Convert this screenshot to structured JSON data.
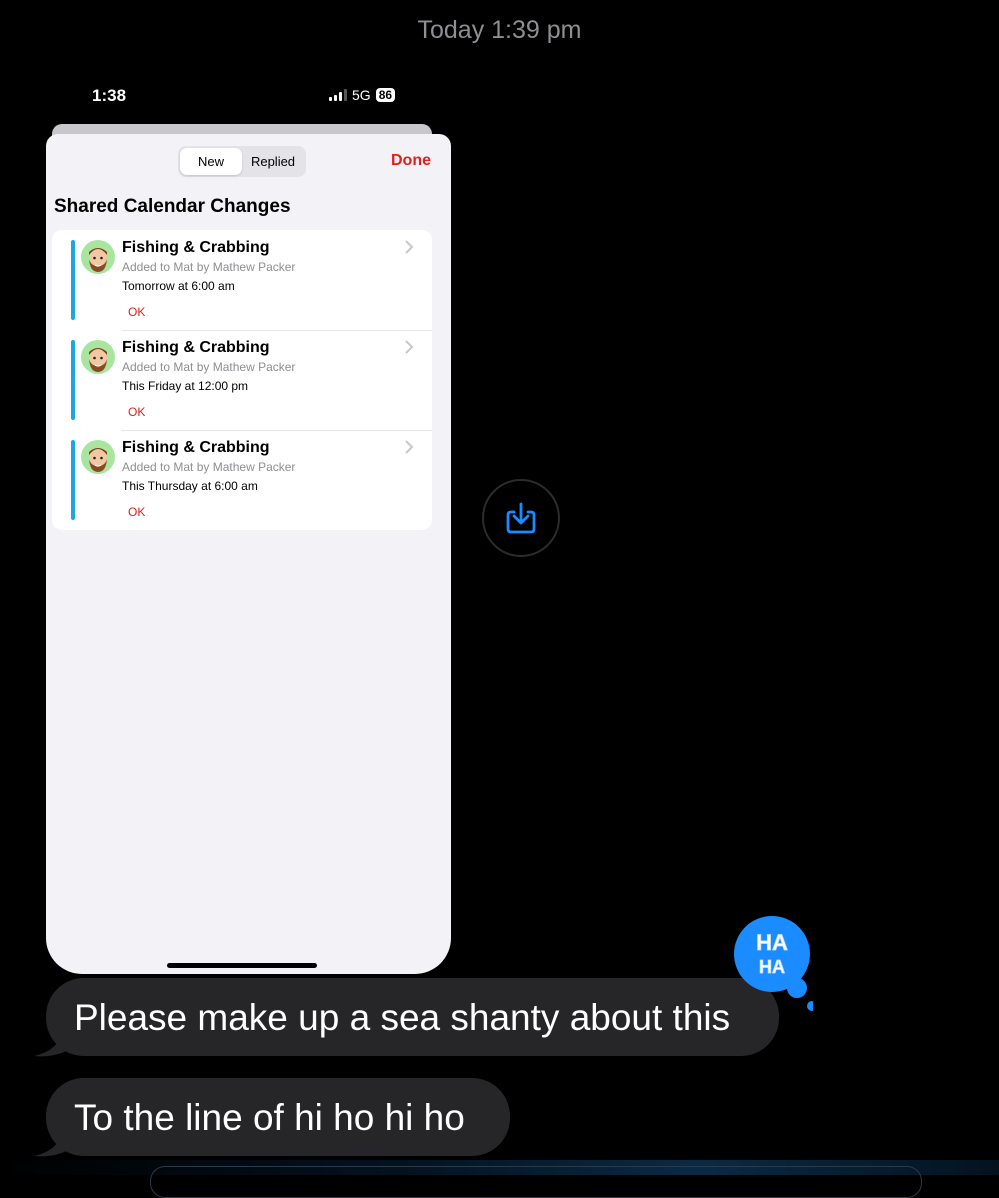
{
  "thread": {
    "timestamp": "Today 1:39 pm"
  },
  "screenshot": {
    "status_bar": {
      "time": "1:38",
      "network": "5G",
      "battery": "86"
    },
    "segments": [
      {
        "label": "New",
        "active": true
      },
      {
        "label": "Replied",
        "active": false
      }
    ],
    "done_label": "Done",
    "title": "Shared Calendar Changes",
    "items": [
      {
        "title": "Fishing & Crabbing",
        "subtitle": "Added to Mat by Mathew Packer",
        "when": "Tomorrow at 6:00 am",
        "action": "OK"
      },
      {
        "title": "Fishing & Crabbing",
        "subtitle": "Added to Mat by Mathew Packer",
        "when": "This Friday at 12:00 pm",
        "action": "OK"
      },
      {
        "title": "Fishing & Crabbing",
        "subtitle": "Added to Mat by Mathew Packer",
        "when": "This Thursday at 6:00 am",
        "action": "OK"
      }
    ],
    "colors": {
      "accent_red": "#e0201b",
      "calendar_blue": "#1aa8e0"
    }
  },
  "messages": [
    {
      "text": "Please make up a sea shanty about this",
      "tapback": "HA HA"
    },
    {
      "text": "To the line of hi ho hi ho"
    }
  ],
  "icons": {
    "save": "save-to-photos-icon",
    "tapback": "haha-tapback-icon"
  },
  "colors": {
    "tapback_blue": "#1a8cff",
    "bubble_gray": "#262628"
  }
}
